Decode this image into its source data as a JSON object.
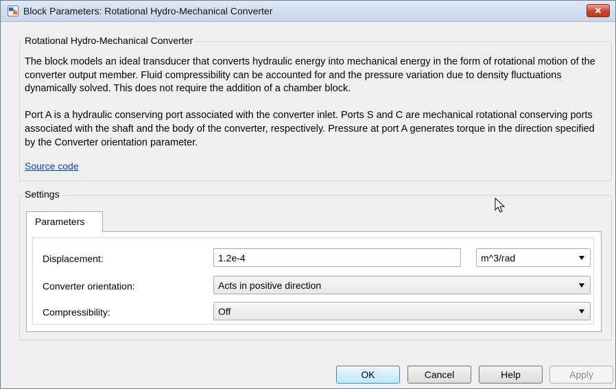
{
  "window": {
    "title": "Block Parameters: Rotational Hydro-Mechanical Converter",
    "close_label": "✕"
  },
  "block": {
    "name": "Rotational Hydro-Mechanical Converter",
    "description_1": "The block models an ideal transducer that converts hydraulic energy into mechanical energy in the form of rotational motion of the converter output member. Fluid compressibility can be accounted for and the pressure variation due to density fluctuations dynamically solved. This does not require the addition of a chamber block.",
    "description_2": "Port A is a hydraulic conserving port associated with the converter inlet. Ports S and C are mechanical rotational conserving ports associated with the shaft and the body of the converter, respectively. Pressure at port A generates torque in the direction specified by the Converter orientation parameter.",
    "source_link": "Source code"
  },
  "settings": {
    "label": "Settings",
    "tab": "Parameters",
    "fields": {
      "displacement": {
        "label": "Displacement:",
        "value": "1.2e-4",
        "unit": "m^3/rad"
      },
      "orientation": {
        "label": "Converter orientation:",
        "value": "Acts in positive direction"
      },
      "compressibility": {
        "label": "Compressibility:",
        "value": "Off"
      }
    }
  },
  "buttons": {
    "ok": "OK",
    "cancel": "Cancel",
    "help": "Help",
    "apply": "Apply"
  },
  "colors": {
    "link": "#0b3fa8",
    "close": "#c7462f"
  }
}
